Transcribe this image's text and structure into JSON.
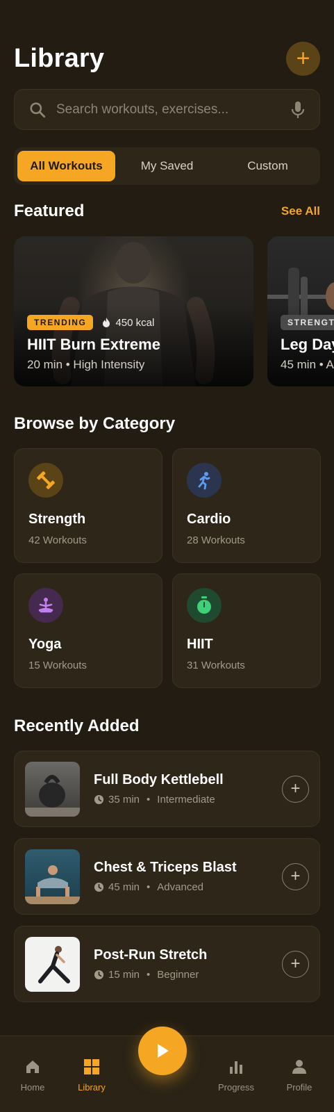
{
  "header": {
    "title": "Library",
    "add_label": "+"
  },
  "search": {
    "placeholder": "Search workouts, exercises..."
  },
  "tabs": [
    {
      "label": "All Workouts",
      "active": true
    },
    {
      "label": "My Saved",
      "active": false
    },
    {
      "label": "Custom",
      "active": false
    }
  ],
  "featured": {
    "title": "Featured",
    "see_all": "See All",
    "cards": [
      {
        "badge": "TRENDING",
        "kcal": "450 kcal",
        "title": "HIIT Burn Extreme",
        "subtitle": "20 min • High Intensity"
      },
      {
        "badge": "STRENGTH",
        "title": "Leg Day",
        "subtitle": "45 min • A"
      }
    ]
  },
  "categories": {
    "title": "Browse by Category",
    "items": [
      {
        "name": "Strength",
        "count": "42 Workouts",
        "icon": "dumbbell-icon",
        "color": "#f5a623",
        "bg": "#5a4316"
      },
      {
        "name": "Cardio",
        "count": "28 Workouts",
        "icon": "running-icon",
        "color": "#5b9cf0",
        "bg": "#2c3550"
      },
      {
        "name": "Yoga",
        "count": "15 Workouts",
        "icon": "yoga-icon",
        "color": "#c17ff0",
        "bg": "#45294f"
      },
      {
        "name": "HIIT",
        "count": "31 Workouts",
        "icon": "stopwatch-icon",
        "color": "#3fd07a",
        "bg": "#1f4a30"
      }
    ]
  },
  "recent": {
    "title": "Recently Added",
    "items": [
      {
        "title": "Full Body Kettlebell",
        "duration": "35 min",
        "level": "Intermediate"
      },
      {
        "title": "Chest & Triceps Blast",
        "duration": "45 min",
        "level": "Advanced"
      },
      {
        "title": "Post-Run Stretch",
        "duration": "15 min",
        "level": "Beginner"
      }
    ]
  },
  "nav": {
    "items": [
      {
        "label": "Home",
        "icon": "home-icon",
        "active": false
      },
      {
        "label": "Library",
        "icon": "grid-icon",
        "active": true
      },
      {
        "label": "Progress",
        "icon": "bar-chart-icon",
        "active": false
      },
      {
        "label": "Profile",
        "icon": "person-icon",
        "active": false
      }
    ],
    "center_icon": "play-icon"
  },
  "colors": {
    "accent": "#f5a623",
    "background": "#221c12",
    "surface": "#2e2618"
  }
}
